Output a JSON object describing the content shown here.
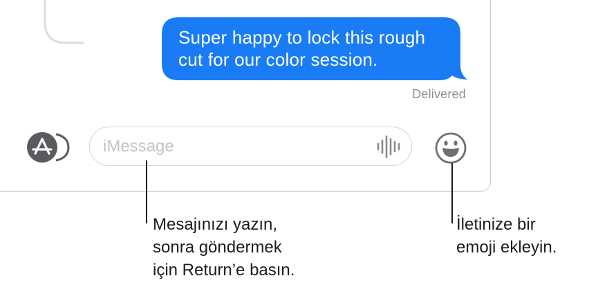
{
  "message": {
    "text_line1": "Super happy to lock this rough",
    "text_line2": "cut for our color session.",
    "status": "Delivered",
    "bubble_color": "#1a7cf5"
  },
  "composer": {
    "placeholder": "iMessage",
    "apps_icon": "app-store-icon",
    "audio_icon": "waveform-icon",
    "emoji_icon": "smiley-face-icon"
  },
  "callouts": {
    "type_message": {
      "line1": "Mesajınızı yazın,",
      "line2": "sonra göndermek",
      "line3": "için Return’e basın."
    },
    "add_emoji": {
      "line1": "İletinize bir",
      "line2": "emoji ekleyin."
    }
  }
}
